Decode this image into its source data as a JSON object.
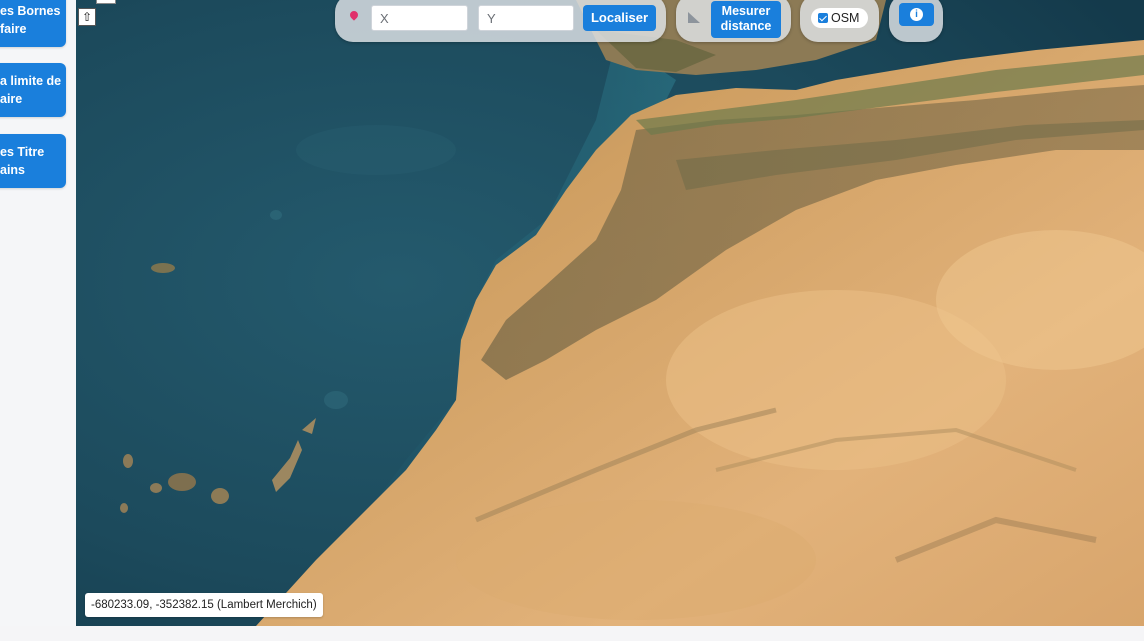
{
  "sidebar": {
    "items": [
      {
        "line1": "es Bornes",
        "line2": "faire"
      },
      {
        "line1": "a limite de",
        "line2": "aire"
      },
      {
        "line1": "es Titre",
        "line2": "ains"
      }
    ]
  },
  "map_controls": {
    "up_arrow": "⇧"
  },
  "toolbar": {
    "x_placeholder": "X",
    "y_placeholder": "Y",
    "locate_label": "Localiser",
    "measure_label_1": "Mesurer",
    "measure_label_2": "distance",
    "osm_label": "OSM",
    "osm_checked": true,
    "info_glyph": "i"
  },
  "status": {
    "coordinates": "-680233.09, -352382.15 (Lambert Merchich)"
  },
  "colors": {
    "accent": "#1a7fdc",
    "ocean": "#1e4d60",
    "desert": "#d9a86a"
  }
}
